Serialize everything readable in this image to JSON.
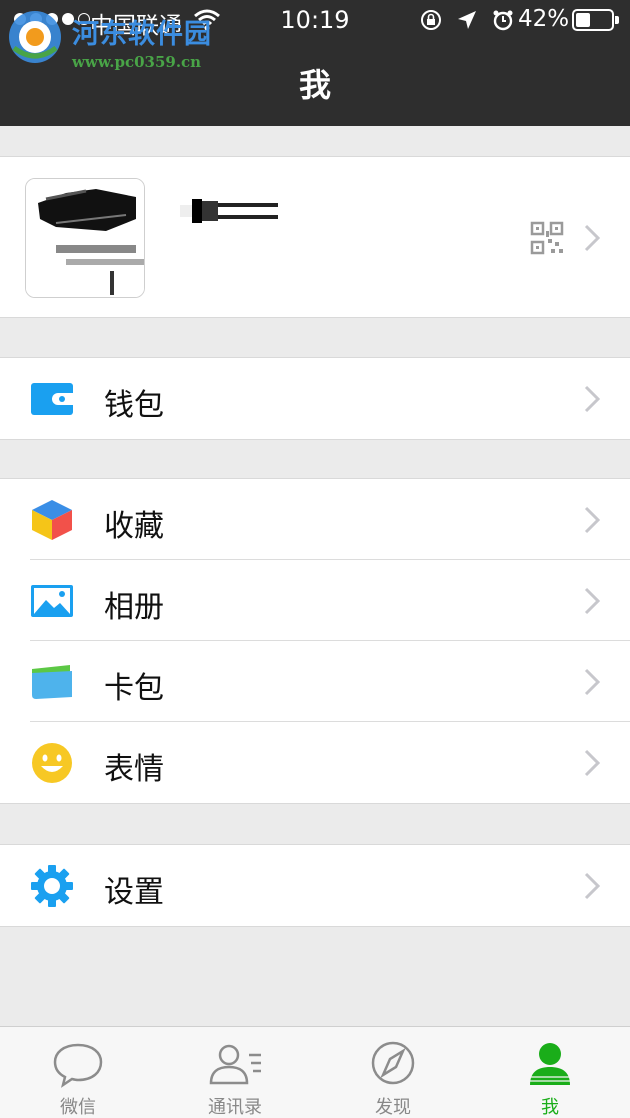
{
  "status_bar": {
    "carrier": "中国联通",
    "time": "10:19",
    "battery": "42%",
    "battery_level": 0.42
  },
  "watermark": {
    "title": "河东软件园",
    "url": "www.pc0359.cn"
  },
  "header": {
    "title": "我"
  },
  "menu": {
    "wallet": "钱包",
    "favorites": "收藏",
    "album": "相册",
    "cards": "卡包",
    "stickers": "表情",
    "settings": "设置"
  },
  "tabs": [
    {
      "label": "微信",
      "icon": "chat-bubble-icon",
      "active": false
    },
    {
      "label": "通讯录",
      "icon": "contacts-icon",
      "active": false
    },
    {
      "label": "发现",
      "icon": "compass-icon",
      "active": false
    },
    {
      "label": "我",
      "icon": "person-icon",
      "active": true
    }
  ],
  "colors": {
    "header_bg": "#2e2e2e",
    "accent_green": "#1aad19",
    "icon_blue": "#1aa0f0"
  }
}
